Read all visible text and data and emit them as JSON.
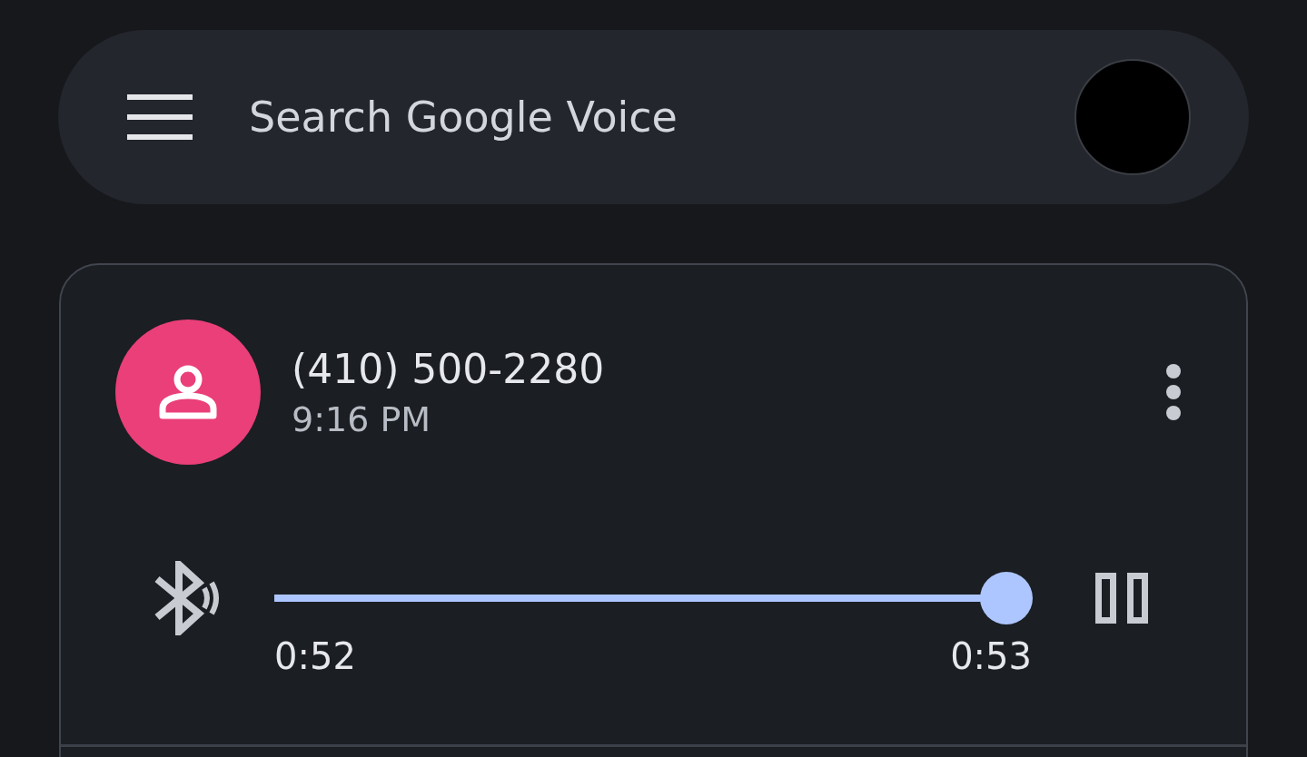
{
  "search": {
    "placeholder": "Search Google Voice"
  },
  "message": {
    "number": "(410) 500-2280",
    "time": "9:16 PM"
  },
  "player": {
    "level": 1,
    "elapsed": "0:52",
    "duration": "0:53",
    "playing": true
  }
}
